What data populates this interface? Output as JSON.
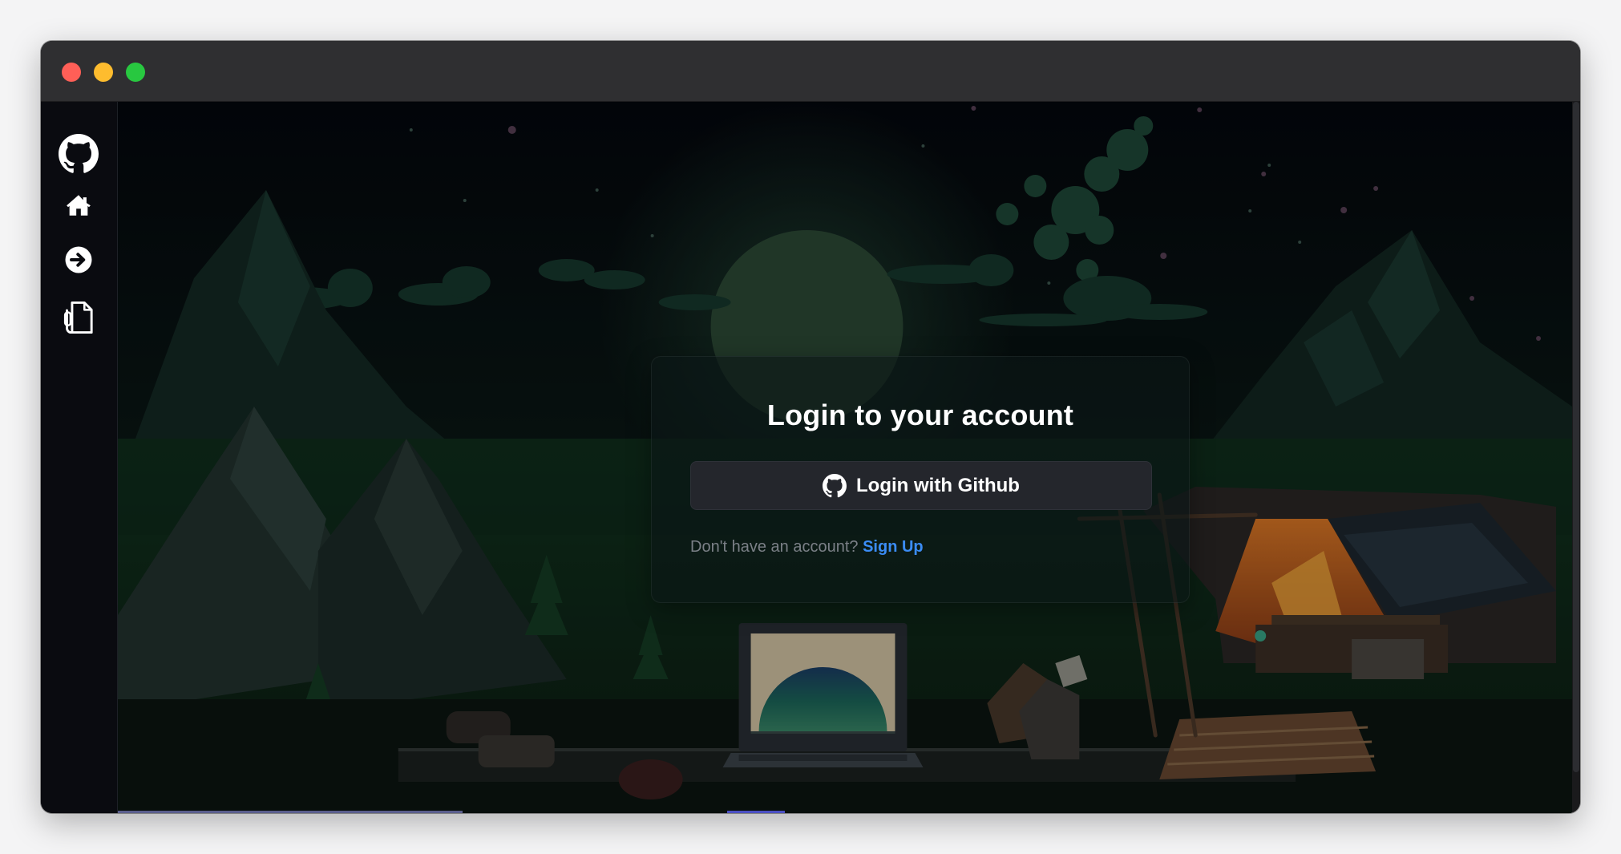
{
  "window": {
    "controls": [
      "close",
      "minimize",
      "maximize"
    ]
  },
  "sidebar": {
    "items": [
      {
        "icon": "github-logo-icon"
      },
      {
        "icon": "home-icon"
      },
      {
        "icon": "login-arrow-icon"
      },
      {
        "icon": "document-icon"
      }
    ]
  },
  "login": {
    "title": "Login to your account",
    "github_button_label": "Login with Github",
    "signup_prompt": "Don't have an account?",
    "signup_link": "Sign Up"
  },
  "colors": {
    "accent_link": "#3b8cf5",
    "button_bg": "#24262c",
    "titlebar": "#2f2f31"
  }
}
